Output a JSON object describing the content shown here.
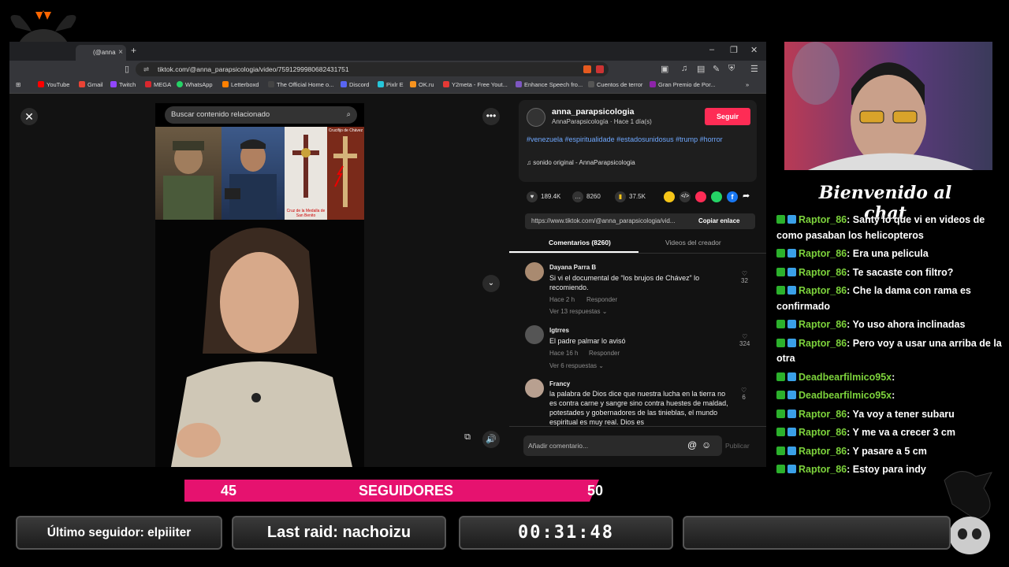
{
  "browser": {
    "tab_label": "(@anna",
    "url": "tiktok.com/@anna_parapsicologia/video/7591299980682431751",
    "bookmarks": [
      "YouTube",
      "Gmail",
      "Twitch",
      "MEGA",
      "WhatsApp",
      "Letterboxd",
      "The Official Home o...",
      "Discord",
      "Pixlr E",
      "OK.ru",
      "Y2meta - Free Yout...",
      "Enhance Speech fro...",
      "Cuentos de terror",
      "Gran Premio de Por..."
    ]
  },
  "tiktok": {
    "search_placeholder": "Buscar contenido relacionado",
    "author_name": "anna_parapsicologia",
    "author_sub": "AnnaParapsicología · Hace 1 día(s)",
    "follow_label": "Seguir",
    "hashtags": "#venezuela #espiritualidade #estadosunidosus #trump #horror",
    "sound": "sonido original - AnnaParapsicologia",
    "likes": "189.4K",
    "comments_count": "8260",
    "saves": "37.5K",
    "link": "https://www.tiktok.com/@anna_parapsicologia/vid...",
    "copy_link": "Copiar enlace",
    "tab_comments": "Comentarios (8260)",
    "tab_creator": "Videos del creador",
    "thumb_caption_1": "Cruz de la Medalla de San Benito",
    "thumb_caption_2": "Crucifijo de Chávez",
    "comments": [
      {
        "name": "Dayana Parra B",
        "text": "Si vi el documental de “los brujos de Chávez” lo recomiendo.",
        "time": "Hace 2 h",
        "reply": "Responder",
        "replies": "Ver 13 respuestas",
        "likes": "32"
      },
      {
        "name": "lgtrres",
        "text": "El padre palmar lo avisó",
        "time": "Hace 16 h",
        "reply": "Responder",
        "replies": "Ver 6 respuestas",
        "likes": "324"
      },
      {
        "name": "Francy",
        "text": "la palabra de Dios dice que nuestra lucha en la tierra no es contra carne y sangre sino contra huestes de maldad, potestades y gobernadores de las tinieblas, el mundo espiritual es muy real. Dios es",
        "likes": "6"
      }
    ],
    "comment_placeholder": "Añadir comentario...",
    "publish": "Publicar"
  },
  "overlay": {
    "welcome": "Bienvenido al chat",
    "followers_current": "45",
    "followers_label": "SEGUIDORES",
    "followers_goal": "50",
    "followers_progress": 0.9,
    "last_follower": "Último seguidor: elpiiiter",
    "last_raid": "Last raid: nachoizu",
    "timer": "00:31:48"
  },
  "chat": [
    {
      "user": "Raptor_86",
      "msg": ": Santy lo que vi en videos de como pasaban los helicopteros"
    },
    {
      "user": "Raptor_86",
      "msg": ": Era una pelicula"
    },
    {
      "user": "Raptor_86",
      "msg": ": Te sacaste con filtro?"
    },
    {
      "user": "Raptor_86",
      "msg": ": Che la dama con rama es confirmado"
    },
    {
      "user": "Raptor_86",
      "msg": ": Yo uso ahora inclinadas"
    },
    {
      "user": "Raptor_86",
      "msg": ": Pero voy a usar una arriba de la otra"
    },
    {
      "user": "Deadbearfilmico95x",
      "msg": ":"
    },
    {
      "user": "Deadbearfilmico95x",
      "msg": ":"
    },
    {
      "user": "Raptor_86",
      "msg": ": Ya voy a tener subaru"
    },
    {
      "user": "Raptor_86",
      "msg": ": Y me va a crecer 3 cm"
    },
    {
      "user": "Raptor_86",
      "msg": ": Y pasare a 5 cm"
    },
    {
      "user": "Raptor_86",
      "msg": ": Estoy para indy"
    }
  ],
  "colors": {
    "accent_pink": "#e6126f",
    "follow_red": "#fe2c55",
    "chat_user": "#7dd33c"
  }
}
